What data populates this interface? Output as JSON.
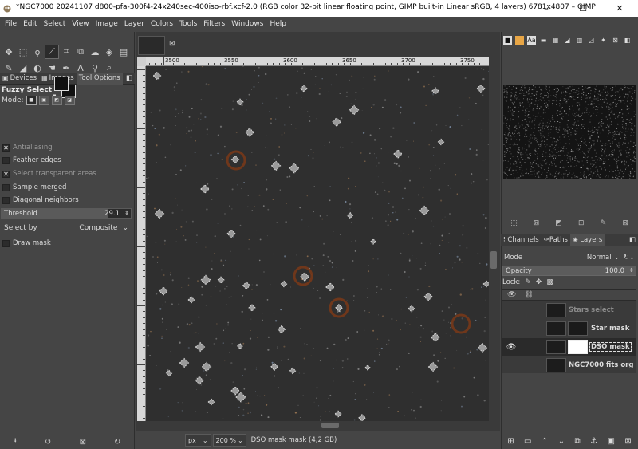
{
  "window": {
    "title": "*NGC7000 20241107 d800-pfa-300f4-24x240sec-400iso-rbf.xcf-2.0 (RGB color 32-bit linear floating point, GIMP built-in Linear sRGB, 4 layers) 6781x4807 – GIMP",
    "minimize": "–",
    "maximize": "☐",
    "close": "✕"
  },
  "menu": [
    "File",
    "Edit",
    "Select",
    "View",
    "Image",
    "Layer",
    "Colors",
    "Tools",
    "Filters",
    "Windows",
    "Help"
  ],
  "tools": {
    "row1": [
      "move-icon",
      "rect-select-icon",
      "free-select-icon",
      "fuzzy-select-icon",
      "crop-icon",
      "unified-transform-icon",
      "warp-icon",
      "bucket-fill-icon",
      "gradient-icon"
    ],
    "row2": [
      "paintbrush-icon",
      "eraser-icon",
      "clone-icon",
      "smudge-icon",
      "path-icon",
      "text-icon",
      "color-picker-icon",
      "zoom-icon"
    ],
    "active": "fuzzy-select-icon"
  },
  "left_tabs": [
    "Devices",
    "Images",
    "Tool Options"
  ],
  "left_tabs_active": "Tool Options",
  "tool_options": {
    "title": "Fuzzy Select",
    "mode_label": "Mode:",
    "antialiasing": "Antialiasing",
    "feather_edges": "Feather edges",
    "select_transparent": "Select transparent areas",
    "sample_merged": "Sample merged",
    "diagonal_neighbors": "Diagonal neighbors",
    "threshold_label": "Threshold",
    "threshold_value": "29.1",
    "threshold_fraction": 0.82,
    "select_by_label": "Select by",
    "select_by_value": "Composite",
    "draw_mask": "Draw mask"
  },
  "ruler": {
    "top_labels": [
      "3500",
      "3550",
      "3600",
      "3650",
      "3700",
      "3750"
    ]
  },
  "status": {
    "unit": "px",
    "zoom": "200 %",
    "message": "DSO mask mask (4,2 GB)"
  },
  "layers_panel": {
    "tabs": [
      "Channels",
      "Paths",
      "Layers"
    ],
    "active_tab": "Layers",
    "mode_label": "Mode",
    "mode_value": "Normal",
    "opacity_label": "Opacity",
    "opacity_value": "100.0",
    "lock_label": "Lock:",
    "layers": [
      {
        "name": "Stars select",
        "visible": false,
        "has_mask": false,
        "dim": true
      },
      {
        "name": "Star mask",
        "visible": false,
        "has_mask": true,
        "dim": false
      },
      {
        "name": "DSO mask",
        "visible": true,
        "has_mask": true,
        "dim": false,
        "active": true
      },
      {
        "name": "NGC7000 fits org",
        "visible": false,
        "has_mask": false,
        "dim": false
      }
    ]
  },
  "colors": {
    "accent_brown": "#8a3a12",
    "selection": "#d8d8d8"
  }
}
